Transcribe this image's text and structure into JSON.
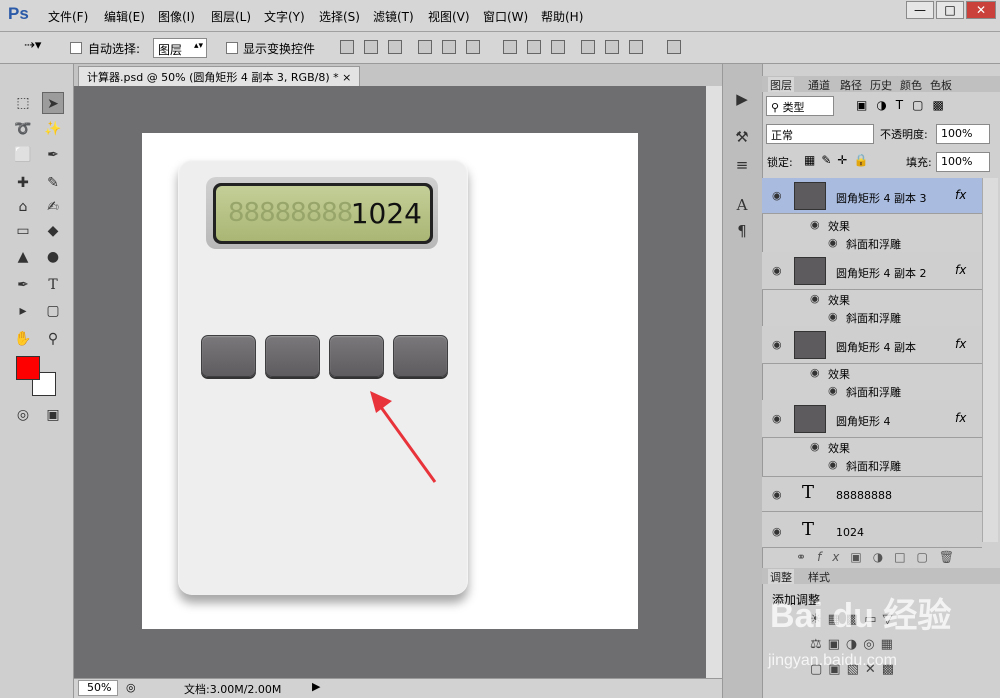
{
  "app": {
    "logo": "Ps"
  },
  "menu": [
    "文件(F)",
    "编辑(E)",
    "图像(I)",
    "图层(L)",
    "文字(Y)",
    "选择(S)",
    "滤镜(T)",
    "视图(V)",
    "窗口(W)",
    "帮助(H)"
  ],
  "window_buttons": [
    "—",
    "□",
    "✕"
  ],
  "options": {
    "auto_select_label": "自动选择:",
    "auto_select_value": "图层",
    "show_transform_label": "显示变换控件"
  },
  "document": {
    "tab_title": "计算器.psd @ 50% (圆角矩形 4 副本 3, RGB/8) *",
    "close": "×",
    "zoom": "50%",
    "doc_size": "文档:3.00M/2.00M"
  },
  "calculator": {
    "lcd_ghost": "88888888",
    "lcd_value": "1024",
    "key_count": 4
  },
  "colors": {
    "foreground": "#ff0000",
    "background": "#ffffff",
    "selected_layer": "#a9bbdf"
  },
  "panel": {
    "tabs": [
      "图层",
      "通道",
      "路径",
      "历史",
      "颜色",
      "色板"
    ],
    "kind_filter": "类型",
    "blend_mode": "正常",
    "opacity_label": "不透明度:",
    "opacity_value": "100%",
    "lock_label": "锁定:",
    "fill_label": "填充:",
    "fill_value": "100%",
    "layers": [
      {
        "name": "圆角矩形 4 副本 3",
        "effects": "效果",
        "bevel": "斜面和浮雕",
        "fx": "fx",
        "selected": true
      },
      {
        "name": "圆角矩形 4 副本 2",
        "effects": "效果",
        "bevel": "斜面和浮雕",
        "fx": "fx"
      },
      {
        "name": "圆角矩形 4 副本",
        "effects": "效果",
        "bevel": "斜面和浮雕",
        "fx": "fx"
      },
      {
        "name": "圆角矩形 4",
        "effects": "效果",
        "bevel": "斜面和浮雕",
        "fx": "fx"
      },
      {
        "name": "88888888",
        "type": "T"
      },
      {
        "name": "1024",
        "type": "T"
      }
    ],
    "footer_fx": "fx"
  },
  "adjust": {
    "tabs": [
      "调整",
      "样式"
    ],
    "title": "添加调整"
  },
  "watermark": {
    "brand": "Bai du 经验",
    "url": "jingyan.baidu.com"
  }
}
